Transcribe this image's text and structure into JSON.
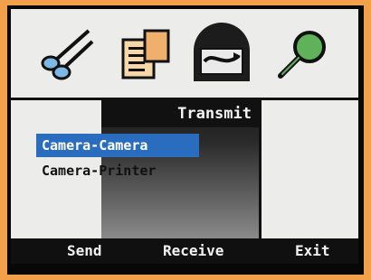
{
  "toolbar": {
    "icons": [
      "scissors-icon",
      "documents-icon",
      "transmit-icon",
      "magnifier-icon"
    ],
    "active": "transmit-icon"
  },
  "menu": {
    "title": "Transmit",
    "options": [
      "Camera-Camera",
      "Camera-Printer"
    ],
    "selected_index": 0
  },
  "softkeys": {
    "left": "Send",
    "center": "Receive",
    "right": "Exit"
  },
  "colors": {
    "frame": "#f2a14a",
    "panel": "#ececea",
    "selection": "#2a6dbf",
    "bar": "#101010"
  }
}
